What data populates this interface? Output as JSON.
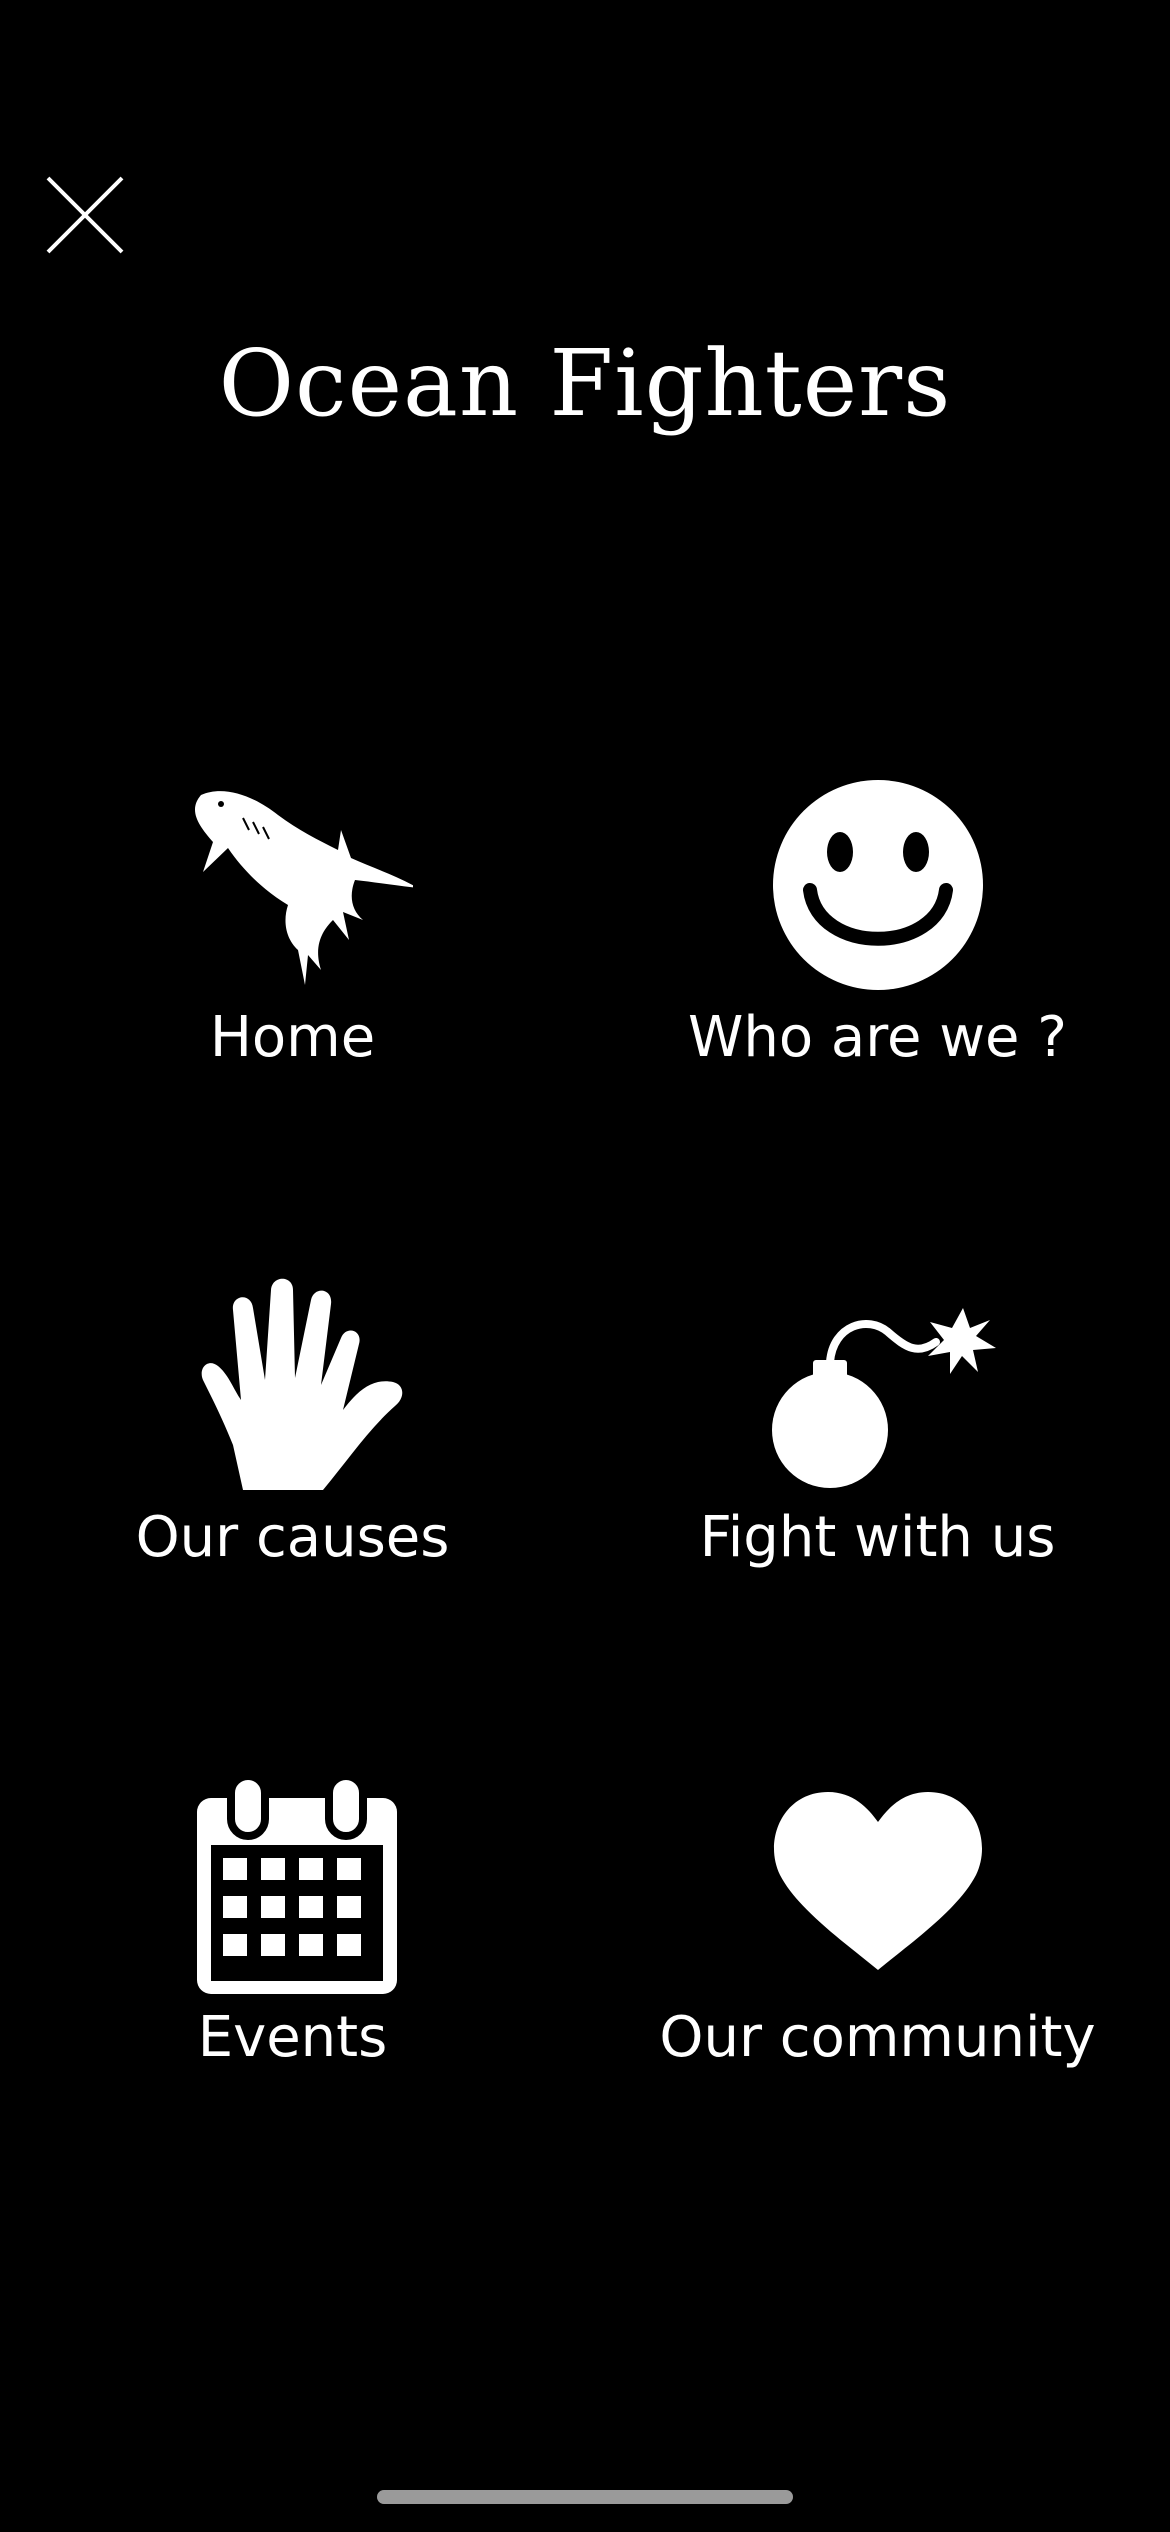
{
  "app": {
    "title": "Ocean Fighters"
  },
  "menu": {
    "items": [
      {
        "label": "Home",
        "icon": "shark-icon"
      },
      {
        "label": "Who are we ?",
        "icon": "smiley-icon"
      },
      {
        "label": "Our causes",
        "icon": "hand-icon"
      },
      {
        "label": "Fight with us",
        "icon": "bomb-icon"
      },
      {
        "label": "Events",
        "icon": "calendar-icon"
      },
      {
        "label": "Our community",
        "icon": "heart-icon"
      }
    ]
  },
  "colors": {
    "background": "#000000",
    "foreground": "#ffffff",
    "home_indicator": "#9a9a9a"
  }
}
